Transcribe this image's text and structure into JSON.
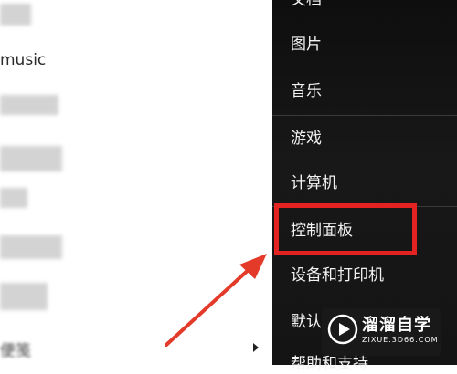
{
  "left_list": {
    "item_music": "music",
    "item_notes": "便笺"
  },
  "start_menu": {
    "items": [
      {
        "label": "文档"
      },
      {
        "label": "图片"
      },
      {
        "label": "音乐"
      },
      {
        "label": "游戏"
      },
      {
        "label": "计算机"
      },
      {
        "label": "控制面板"
      },
      {
        "label": "设备和打印机"
      },
      {
        "label": "默认"
      },
      {
        "label": "帮助和支持"
      }
    ]
  },
  "watermark": {
    "title": "溜溜自学",
    "url": "ZIXUE.3D66.COM"
  },
  "colors": {
    "menu_bg": "#121212",
    "highlight": "#e32222",
    "menu_text": "#f2f2f2"
  }
}
